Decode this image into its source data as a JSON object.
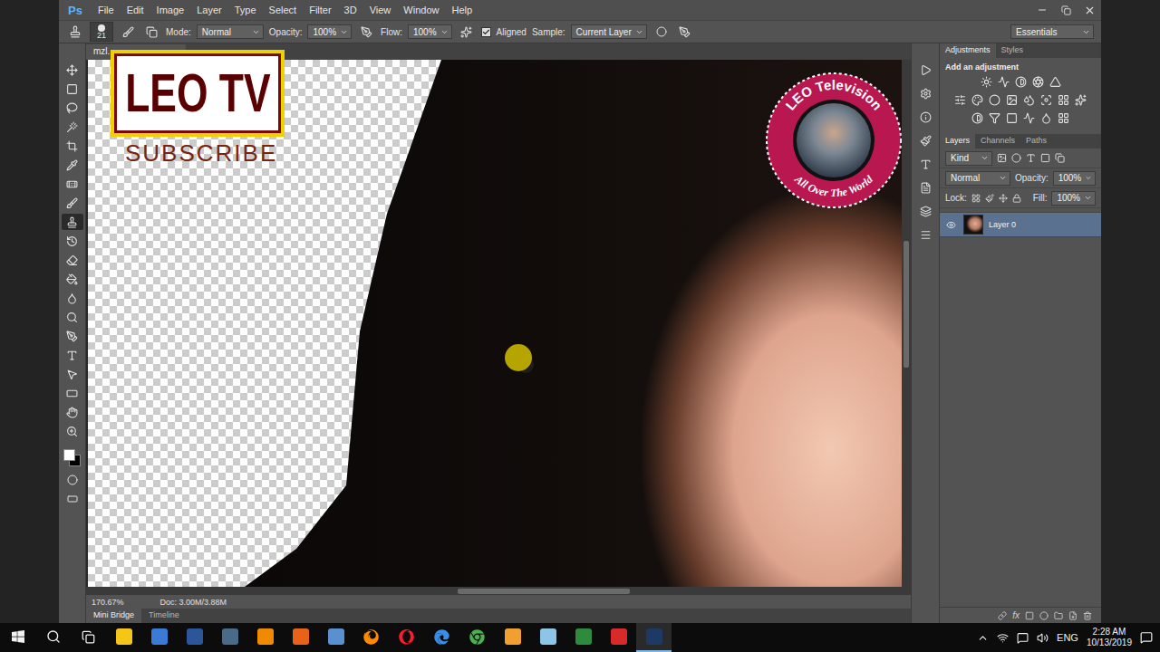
{
  "window": {
    "logo": "Ps",
    "menu": [
      "File",
      "Edit",
      "Image",
      "Layer",
      "Type",
      "Select",
      "Filter",
      "3D",
      "View",
      "Window",
      "Help"
    ]
  },
  "toolbar": {
    "tools": [
      {
        "selected": false
      },
      {
        "selected": false
      },
      {
        "selected": false
      },
      {
        "selected": false
      },
      {
        "selected": false
      },
      {
        "selected": false
      },
      {
        "selected": false
      },
      {
        "selected": false
      },
      {
        "selected": true
      },
      {
        "selected": false
      },
      {
        "selected": false
      },
      {
        "selected": false
      },
      {
        "selected": false
      },
      {
        "selected": false
      },
      {
        "selected": false
      },
      {
        "selected": false
      },
      {
        "selected": false
      },
      {
        "selected": false
      },
      {
        "selected": false
      },
      {
        "selected": false
      }
    ]
  },
  "options_bar": {
    "brush_size": "21",
    "mode_label": "Mode:",
    "mode": "Normal",
    "opacity_label": "Opacity:",
    "opacity": "100%",
    "flow_label": "Flow:",
    "flow": "100%",
    "aligned": {
      "label": "Aligned",
      "checked": true
    },
    "sample_label": "Sample:",
    "sample": "Current Layer",
    "workspace": "Essentials"
  },
  "document": {
    "tab": "mzl.",
    "zoom": "170.67%",
    "doc_size": "Doc: 3.00M/3.88M"
  },
  "bottom_tabs": [
    {
      "label": "Mini Bridge",
      "selected": true
    },
    {
      "label": "Timeline",
      "selected": false
    }
  ],
  "adjustments_panel": {
    "tabs": [
      {
        "label": "Adjustments",
        "selected": true
      },
      {
        "label": "Styles",
        "selected": false
      }
    ],
    "heading": "Add an adjustment"
  },
  "layers_panel": {
    "tabs": [
      {
        "label": "Layers",
        "selected": true
      },
      {
        "label": "Channels",
        "selected": false
      },
      {
        "label": "Paths",
        "selected": false
      }
    ],
    "filter": "Kind",
    "blend_mode": "Normal",
    "opacity_label": "Opacity:",
    "opacity": "100%",
    "lock_label": "Lock:",
    "fill_label": "Fill:",
    "fill": "100%",
    "layers": [
      {
        "name": "Layer 0",
        "visible": true,
        "selected": true
      }
    ],
    "effects_label": "fx"
  },
  "overlay": {
    "channel": "LEO TV",
    "call_to_action": "SUBSCRIBE",
    "badge_top": "LEO Television",
    "badge_bottom": "All Over The World"
  },
  "taskbar": {
    "language": "ENG",
    "time": "2:28 AM",
    "date": "10/13/2019"
  }
}
